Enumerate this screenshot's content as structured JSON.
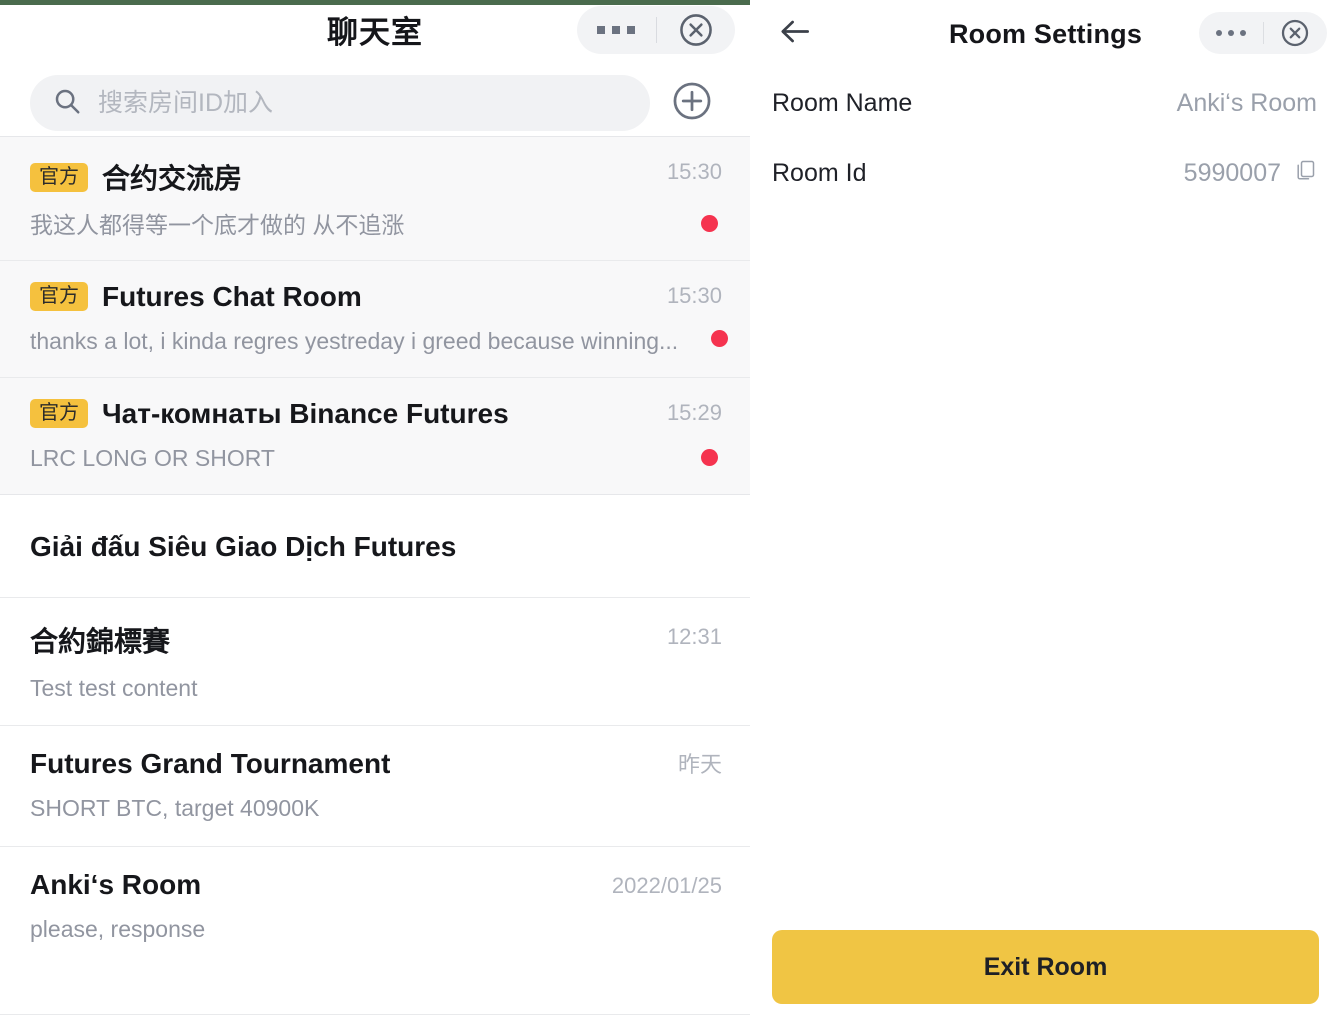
{
  "theme": {
    "accent_yellow": "#F0C544",
    "badge_yellow": "#F5C13E",
    "unread_red": "#F5334F",
    "top_strip_green": "#4A6B4D",
    "text_primary": "#16171B",
    "text_muted": "#9195A0",
    "panel_grey": "#F8F8F9"
  },
  "left_panel": {
    "header": {
      "title": "聊天室",
      "more_icon": "more-dots-icon",
      "close_icon": "close-circle-icon"
    },
    "search": {
      "placeholder": "搜索房间ID加入",
      "value": "",
      "icon": "search-icon"
    },
    "add_button": {
      "icon": "plus-circle-icon"
    },
    "official_rooms": [
      {
        "badge": "官方",
        "name": "合约交流房",
        "preview": "我这人都得等一个底才做的 从不追涨",
        "time": "15:30",
        "unread": true
      },
      {
        "badge": "官方",
        "name": "Futures Chat Room",
        "preview": "thanks a lot, i kinda regres yestreday i greed because winning...",
        "time": "15:30",
        "unread": true
      },
      {
        "badge": "官方",
        "name": "Чат-комнаты Binance Futures",
        "preview": "LRC LONG OR SHORT",
        "time": "15:29",
        "unread": true
      }
    ],
    "section_title": "Giải đấu Siêu Giao Dịch Futures",
    "rooms": [
      {
        "name": "合約錦標賽",
        "preview": "Test test content",
        "time": "12:31",
        "unread": false
      },
      {
        "name": "Futures Grand Tournament",
        "preview": "SHORT BTC, target 40900K",
        "time": "昨天",
        "unread": false
      },
      {
        "name": "Anki‘s Room",
        "preview": "please, response",
        "time": "2022/01/25",
        "unread": false
      }
    ]
  },
  "right_panel": {
    "header": {
      "back_icon": "arrow-left-icon",
      "title": "Room Settings",
      "more_icon": "more-dots-icon",
      "close_icon": "close-circle-icon"
    },
    "settings": [
      {
        "label": "Room Name",
        "value": "Anki‘s Room",
        "has_copy": false
      },
      {
        "label": "Room Id",
        "value": "5990007",
        "has_copy": true
      }
    ],
    "copy_icon": "copy-icon",
    "exit_button": "Exit Room"
  }
}
